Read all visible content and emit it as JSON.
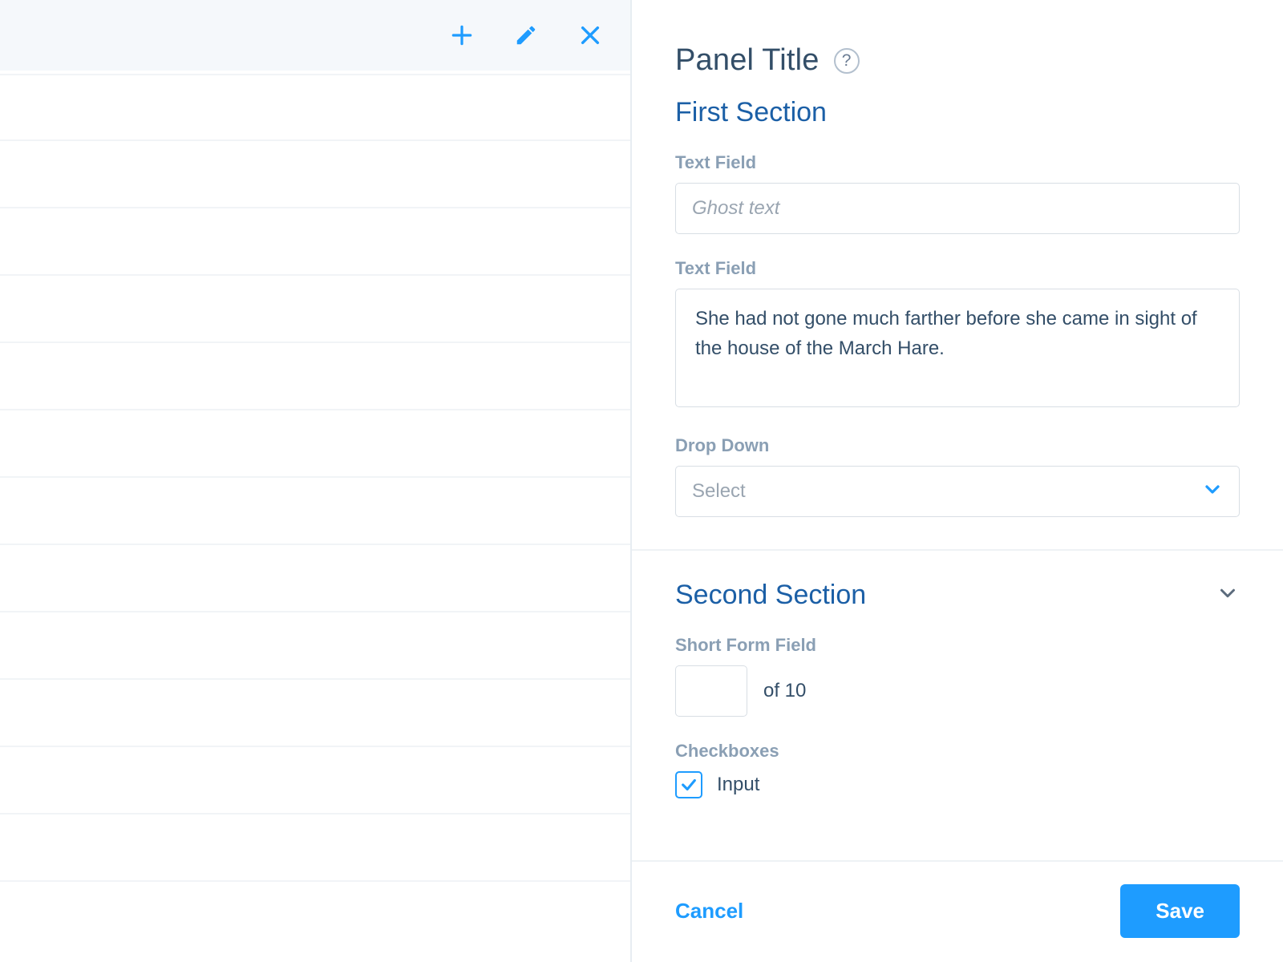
{
  "toolbar": {
    "add_icon": "plus",
    "edit_icon": "pencil",
    "close_icon": "x"
  },
  "panel": {
    "title": "Panel Title",
    "help_glyph": "?"
  },
  "section1": {
    "title": "First Section",
    "text_field_label": "Text Field",
    "text_field_placeholder": "Ghost text",
    "text_field_value": "",
    "textarea_label": "Text Field",
    "textarea_value": "She had not gone much farther before she came in sight of the house of the March Hare.",
    "dropdown_label": "Drop Down",
    "dropdown_selected": "Select"
  },
  "section2": {
    "title": "Second Section",
    "short_label": "Short Form Field",
    "short_value": "",
    "short_suffix": "of 10",
    "checkboxes_label": "Checkboxes",
    "checkbox1_label": "Input",
    "checkbox1_checked": true
  },
  "footer": {
    "cancel_label": "Cancel",
    "save_label": "Save"
  }
}
